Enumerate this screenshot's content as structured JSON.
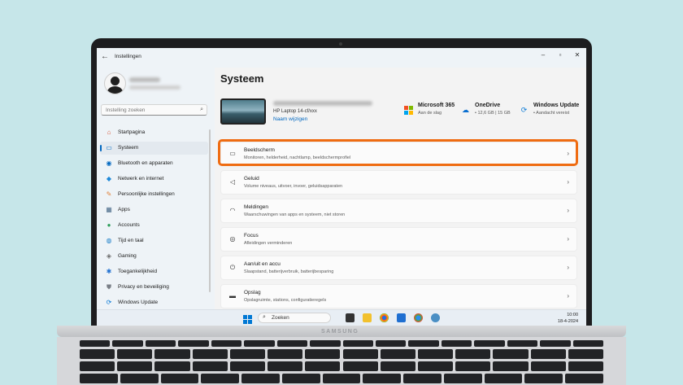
{
  "app": {
    "title": "Instellingen"
  },
  "user": {
    "name_blurred": "",
    "email_blurred": ""
  },
  "sidebar": {
    "search_placeholder": "Instelling zoeken",
    "items": [
      {
        "label": "Startpagina",
        "icon": "home-icon",
        "active": false
      },
      {
        "label": "Systeem",
        "icon": "system-icon",
        "active": true
      },
      {
        "label": "Bluetooth en apparaten",
        "icon": "bluetooth-icon",
        "active": false
      },
      {
        "label": "Netwerk en internet",
        "icon": "wifi-icon",
        "active": false
      },
      {
        "label": "Persoonlijke instellingen",
        "icon": "brush-icon",
        "active": false
      },
      {
        "label": "Apps",
        "icon": "apps-icon",
        "active": false
      },
      {
        "label": "Accounts",
        "icon": "accounts-icon",
        "active": false
      },
      {
        "label": "Tijd en taal",
        "icon": "globe-clock-icon",
        "active": false
      },
      {
        "label": "Gaming",
        "icon": "gamepad-icon",
        "active": false
      },
      {
        "label": "Toegankelijkheid",
        "icon": "accessibility-icon",
        "active": false
      },
      {
        "label": "Privacy en beveiliging",
        "icon": "shield-icon",
        "active": false
      },
      {
        "label": "Windows Update",
        "icon": "update-icon",
        "active": false
      }
    ]
  },
  "main": {
    "title": "Systeem",
    "device": {
      "model": "HP Laptop 14-cf/xxx",
      "rename": "Naam wijzigen"
    },
    "quick_info": [
      {
        "title": "Microsoft 365",
        "sub": "Aan de slag",
        "icon": "microsoft-365-icon"
      },
      {
        "title": "OneDrive",
        "sub": "• 12,6 GB | 15 GB",
        "icon": "onedrive-icon"
      },
      {
        "title": "Windows Update",
        "sub": "• Aandacht vereist",
        "icon": "windows-update-icon"
      }
    ],
    "cards": [
      {
        "title": "Beeldscherm",
        "sub": "Monitoren, helderheid, nachtlamp, beeldschermprofiel",
        "icon": "display-icon",
        "highlighted": true
      },
      {
        "title": "Geluid",
        "sub": "Volume niveaus, uitvoer, invoer, geluidsapparaten",
        "icon": "speaker-icon"
      },
      {
        "title": "Meldingen",
        "sub": "Waarschuwingen van apps en systeem, niet storen",
        "icon": "bell-icon"
      },
      {
        "title": "Focus",
        "sub": "Afleidingen verminderen",
        "icon": "focus-icon"
      },
      {
        "title": "Aan/uit en accu",
        "sub": "Slaapstand, batterijverbruik, batterijbesparing",
        "icon": "power-icon"
      },
      {
        "title": "Opslag",
        "sub": "Opslagruimte, stations, configuratieregels",
        "icon": "storage-icon"
      }
    ]
  },
  "taskbar": {
    "search_label": "Zoeken",
    "time": "10:00",
    "date": "18-4-2024"
  },
  "laptop": {
    "brand": "SAMSUNG"
  },
  "colors": {
    "accent": "#0067c0",
    "highlight": "#ef6c12"
  }
}
